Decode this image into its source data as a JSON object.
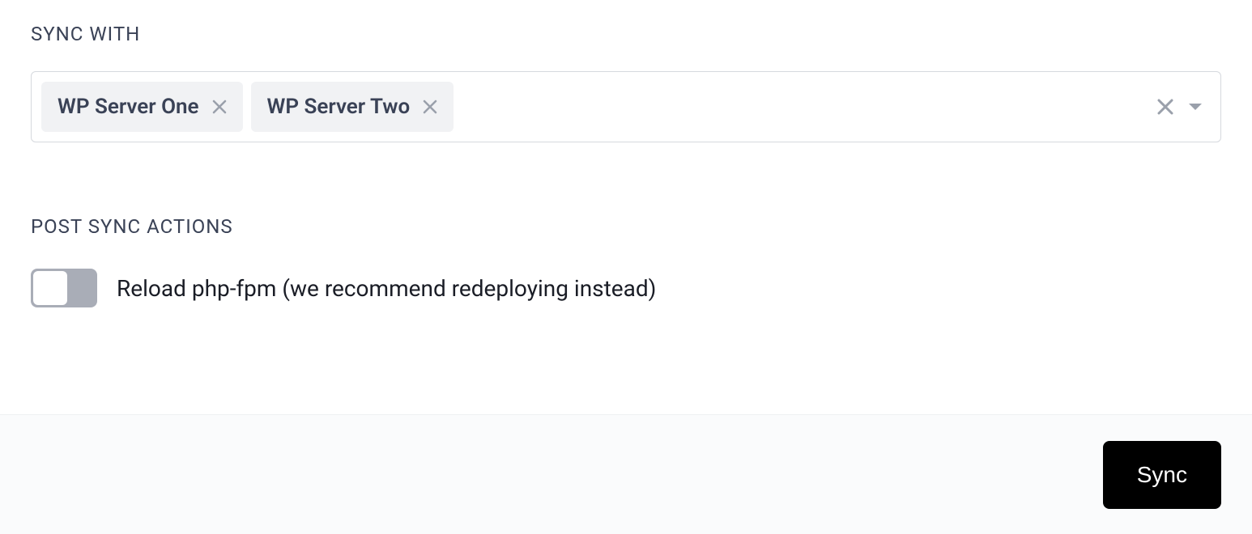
{
  "sync_with": {
    "label": "SYNC WITH",
    "tags": [
      {
        "label": "WP Server One"
      },
      {
        "label": "WP Server Two"
      }
    ]
  },
  "post_sync": {
    "label": "POST SYNC ACTIONS",
    "reload_phpfpm": {
      "label": "Reload php-fpm (we recommend redeploying instead)",
      "enabled": false
    }
  },
  "footer": {
    "sync_label": "Sync"
  }
}
